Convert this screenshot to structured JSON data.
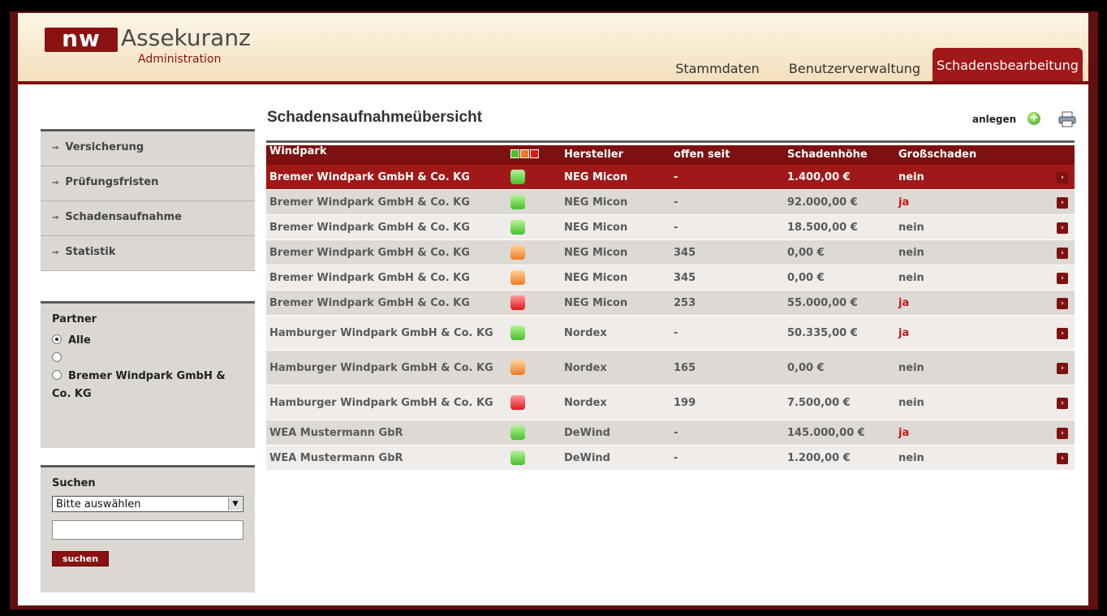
{
  "brand": {
    "logo_mark": "nw",
    "name": "Assekuranz",
    "subtitle": "Administration"
  },
  "tabs": [
    {
      "label": "Stammdaten",
      "active": false
    },
    {
      "label": "Benutzerverwaltung",
      "active": false
    },
    {
      "label": "Schadensbearbeitung",
      "active": true
    }
  ],
  "sidebar": {
    "items": [
      {
        "label": "Versicherung"
      },
      {
        "label": "Prüfungsfristen"
      },
      {
        "label": "Schadensaufnahme"
      },
      {
        "label": "Statistik"
      }
    ],
    "arrow": "→"
  },
  "partner": {
    "title": "Partner",
    "options": [
      {
        "label": "Alle",
        "selected": true
      },
      {
        "label": "",
        "selected": false
      },
      {
        "label": "Bremer Windpark GmbH & Co. KG",
        "selected": false
      }
    ]
  },
  "search": {
    "title": "Suchen",
    "select_value": "Bitte auswählen",
    "input_value": "",
    "button_label": "suchen"
  },
  "main": {
    "title": "Schadensaufnahmeübersicht",
    "add_label": "anlegen",
    "icons": {
      "add": "plus-circle-icon",
      "print": "printer-icon"
    }
  },
  "table": {
    "headers": {
      "windpark": "Windpark",
      "status": "",
      "hersteller": "Hersteller",
      "offen_seit": "offen seit",
      "schadenhoehe": "Schadenhöhe",
      "grossschaden": "Großschaden"
    },
    "status_legend": [
      "#46c22a",
      "#f07a22",
      "#e01818"
    ],
    "rows": [
      {
        "windpark": "Bremer Windpark GmbH & Co. KG",
        "status": "green",
        "hersteller": "NEG Micon",
        "offen_seit": "-",
        "schadenhoehe": "1.400,00 €",
        "grossschaden": "nein",
        "active": true
      },
      {
        "windpark": "Bremer Windpark GmbH & Co. KG",
        "status": "green",
        "hersteller": "NEG Micon",
        "offen_seit": "-",
        "schadenhoehe": "92.000,00 €",
        "grossschaden": "ja",
        "active": false
      },
      {
        "windpark": "Bremer Windpark GmbH & Co. KG",
        "status": "green",
        "hersteller": "NEG Micon",
        "offen_seit": "-",
        "schadenhoehe": "18.500,00 €",
        "grossschaden": "nein",
        "active": false
      },
      {
        "windpark": "Bremer Windpark GmbH & Co. KG",
        "status": "orange",
        "hersteller": "NEG Micon",
        "offen_seit": "345",
        "schadenhoehe": "0,00 €",
        "grossschaden": "nein",
        "active": false
      },
      {
        "windpark": "Bremer Windpark GmbH & Co. KG",
        "status": "orange",
        "hersteller": "NEG Micon",
        "offen_seit": "345",
        "schadenhoehe": "0,00 €",
        "grossschaden": "nein",
        "active": false
      },
      {
        "windpark": "Bremer Windpark GmbH & Co. KG",
        "status": "red",
        "hersteller": "NEG Micon",
        "offen_seit": "253",
        "schadenhoehe": "55.000,00 €",
        "grossschaden": "ja",
        "active": false
      },
      {
        "windpark": "Hamburger Windpark GmbH & Co. KG",
        "status": "green",
        "hersteller": "Nordex",
        "offen_seit": "-",
        "schadenhoehe": "50.335,00 €",
        "grossschaden": "ja",
        "active": false
      },
      {
        "windpark": "Hamburger Windpark GmbH & Co. KG",
        "status": "orange",
        "hersteller": "Nordex",
        "offen_seit": "165",
        "schadenhoehe": "0,00 €",
        "grossschaden": "nein",
        "active": false
      },
      {
        "windpark": "Hamburger Windpark GmbH & Co. KG",
        "status": "red",
        "hersteller": "Nordex",
        "offen_seit": "199",
        "schadenhoehe": "7.500,00 €",
        "grossschaden": "nein",
        "active": false
      },
      {
        "windpark": "WEA Mustermann GbR",
        "status": "green",
        "hersteller": "DeWind",
        "offen_seit": "-",
        "schadenhoehe": "145.000,00 €",
        "grossschaden": "ja",
        "active": false
      },
      {
        "windpark": "WEA Mustermann GbR",
        "status": "green",
        "hersteller": "DeWind",
        "offen_seit": "-",
        "schadenhoehe": "1.200,00 €",
        "grossschaden": "nein",
        "active": false
      }
    ],
    "row_action_glyph": "›"
  }
}
